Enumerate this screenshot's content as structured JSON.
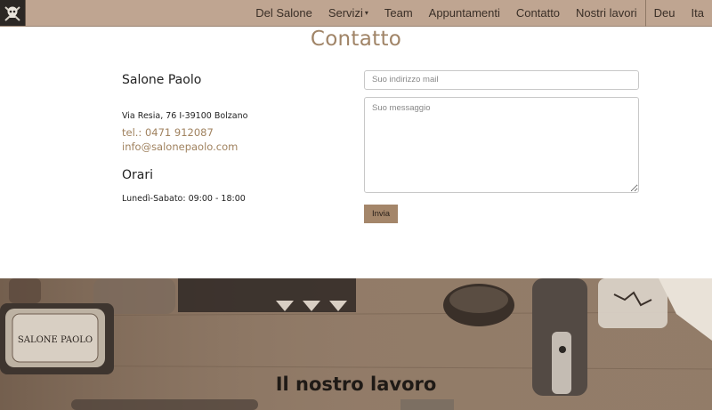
{
  "nav": {
    "items": [
      {
        "label": "Del Salone"
      },
      {
        "label": "Servizi"
      },
      {
        "label": "Team"
      },
      {
        "label": "Appuntamenti"
      },
      {
        "label": "Contatto"
      },
      {
        "label": "Nostri lavori"
      }
    ],
    "languages": [
      "Deu",
      "Ita"
    ]
  },
  "contact": {
    "title": "Contatto",
    "salon_name": "Salone Paolo",
    "address": "Via Resia, 76 I-39100 Bolzano",
    "phone": "tel.: 0471 912087",
    "email": "info@salonepaolo.com",
    "hours_title": "Orari",
    "hours": "Lunedì-Sabato: 09:00 - 18:00",
    "form": {
      "email_placeholder": "Suo indirizzo mail",
      "message_placeholder": "Suo messaggio",
      "submit_label": "Invia"
    }
  },
  "work": {
    "title": "Il nostro lavoro",
    "tin_label": "SALONE PAOLO"
  },
  "colors": {
    "navbar": "#bfa591",
    "accent": "#a08467",
    "button": "#a4866a"
  }
}
